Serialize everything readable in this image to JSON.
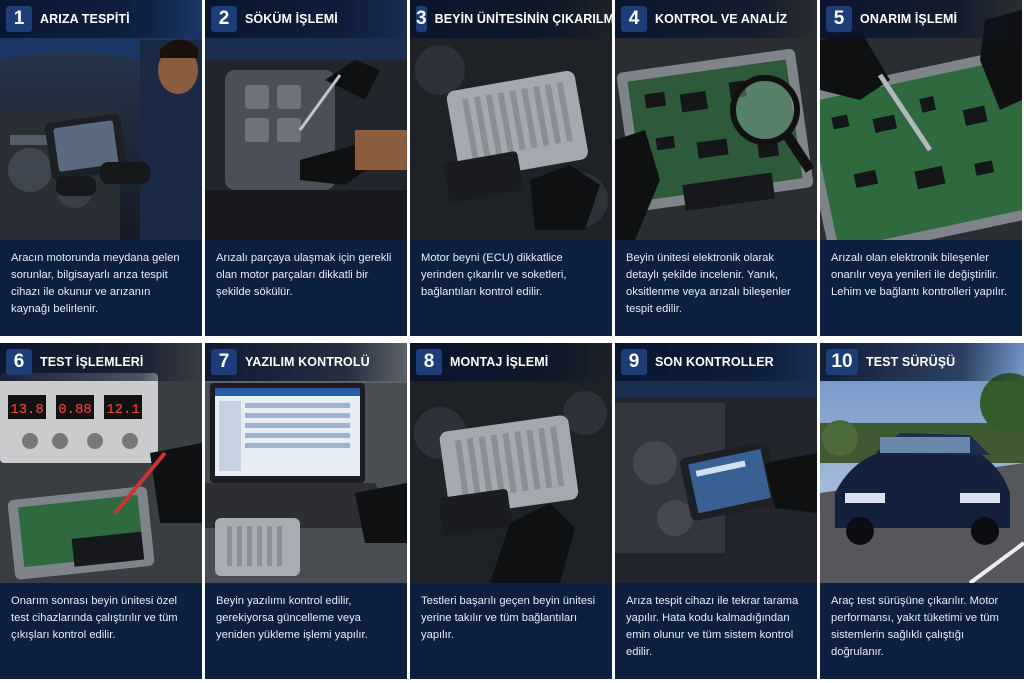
{
  "steps": [
    {
      "num": "1",
      "title": "ARIZA TESPİTİ",
      "text": "Aracın motorunda meydana gelen sorunlar, bilgisayarlı arıza tespit cihazı ile okunur ve arızanın kaynağı belirlenir."
    },
    {
      "num": "2",
      "title": "SÖKÜM İŞLEMİ",
      "text": "Arızalı parçaya ulaşmak için gerekli olan motor parçaları dikkatli bir şekilde sökülür."
    },
    {
      "num": "3",
      "title": "BEYİN ÜNİTESİNİN ÇIKARILMASI",
      "text": "Motor beyni (ECU) dikkatlice yerinden çıkarılır ve soketleri, bağlantıları kontrol edilir."
    },
    {
      "num": "4",
      "title": "KONTROL VE ANALİZ",
      "text": "Beyin ünitesi elektronik olarak detaylı şekilde incelenir. Yanık, oksitlenme veya arızalı bileşenler tespit edilir."
    },
    {
      "num": "5",
      "title": "ONARIM İŞLEMİ",
      "text": "Arızalı olan elektronik bileşenler onarılır veya yenileri ile değiştirilir. Lehim ve bağlantı kontrolleri yapılır."
    },
    {
      "num": "6",
      "title": "TEST İŞLEMLERİ",
      "text": "Onarım sonrası beyin ünitesi özel test cihazlarında çalıştırılır ve tüm çıkışları kontrol edilir."
    },
    {
      "num": "7",
      "title": "YAZILIM KONTROLÜ",
      "text": "Beyin yazılımı kontrol edilir, gerekiyorsa güncelleme veya yeniden yükleme işlemi yapılır."
    },
    {
      "num": "8",
      "title": "MONTAJ İŞLEMİ",
      "text": "Testleri başarılı geçen beyin ünitesi yerine takılır ve tüm bağlantıları yapılır."
    },
    {
      "num": "9",
      "title": "SON KONTROLLER",
      "text": "Arıza tespit cihazı ile tekrar tarama yapılır. Hata kodu kalmadığından emin olunur ve tüm sistem kontrol edilir."
    },
    {
      "num": "10",
      "title": "TEST SÜRÜŞÜ",
      "text": "Araç test sürüşüne çıkarılır. Motor performansı, yakıt tüketimi ve tüm sistemlerin sağlıklı çalıştığı doğrulanır."
    }
  ],
  "test_device_readouts": [
    "13.8",
    "0.88",
    "12.1"
  ],
  "colors": {
    "panel": "#0d1f3f",
    "badge": "#1d3d7a",
    "text": "#e8edf6"
  }
}
